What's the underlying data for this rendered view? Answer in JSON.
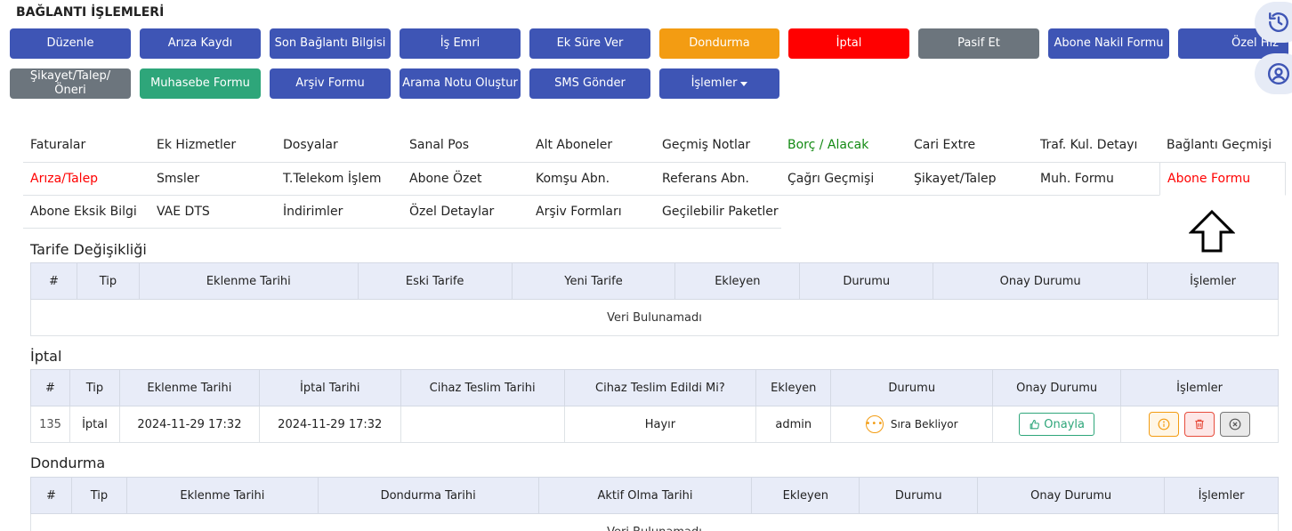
{
  "header": {
    "title": "BAĞLANTI İŞLEMLERİ"
  },
  "toolbar": {
    "row1": [
      "Düzenle",
      "Arıza Kaydı",
      "Son Bağlantı Bilgisi",
      "İş Emri",
      "Ek Süre Ver",
      "Dondurma",
      "İptal",
      "Pasif Et",
      "Abone Nakil Formu",
      "Özel Hız"
    ],
    "row2": [
      "Şikayet/Talep/ Öneri",
      "Muhasebe Formu",
      "Arşiv Formu",
      "Arama Notu Oluştur",
      "SMS Gönder",
      "İşlemler"
    ]
  },
  "colors": {
    "blue": "#3e55b5",
    "orange": "#f39c12",
    "red": "#ff0000",
    "gray": "#6c757d",
    "green": "#2ea67a"
  },
  "side_icons": [
    "history-icon",
    "user-circle-icon"
  ],
  "tabs": {
    "row1": [
      "Faturalar",
      "Ek Hizmetler",
      "Dosyalar",
      "Sanal Pos",
      "Alt Aboneler",
      "Geçmiş Notlar",
      "Borç / Alacak",
      "Cari Extre",
      "Traf. Kul. Detayı",
      "Bağlantı Geçmişi"
    ],
    "row2": [
      "Arıza/Talep",
      "Smsler",
      "T.Telekom İşlem",
      "Abone Özet",
      "Komşu Abn.",
      "Referans Abn.",
      "Çağrı Geçmişi",
      "Şikayet/Talep",
      "Muh. Formu",
      "Abone Formu"
    ],
    "row3": [
      "Abone Eksik Bilgi",
      "VAE DTS",
      "İndirimler",
      "Özel Detaylar",
      "Arşiv Formları",
      "Geçilebilir Paketler"
    ],
    "active": "Abone Formu"
  },
  "tarife": {
    "title": "Tarife Değişikliği",
    "columns": [
      "#",
      "Tip",
      "Eklenme Tarihi",
      "Eski Tarife",
      "Yeni Tarife",
      "Ekleyen",
      "Durumu",
      "Onay Durumu",
      "İşlemler"
    ],
    "empty": "Veri Bulunamadı"
  },
  "iptal": {
    "title": "İptal",
    "columns": [
      "#",
      "Tip",
      "Eklenme Tarihi",
      "İptal Tarihi",
      "Cihaz Teslim Tarihi",
      "Cihaz Teslim Edildi Mi?",
      "Ekleyen",
      "Durumu",
      "Onay Durumu",
      "İşlemler"
    ],
    "row": {
      "id": "135",
      "tip": "İptal",
      "eklenme": "2024-11-29 17:32",
      "iptal": "2024-11-29 17:32",
      "teslim_tarihi": "",
      "teslim_edildi": "Hayır",
      "ekleyen": "admin",
      "durum": "Sıra Bekliyor",
      "onay": "Onayla"
    }
  },
  "dondurma": {
    "title": "Dondurma",
    "columns": [
      "#",
      "Tip",
      "Eklenme Tarihi",
      "Dondurma Tarihi",
      "Aktif Olma Tarihi",
      "Ekleyen",
      "Durumu",
      "Onay Durumu",
      "İşlemler"
    ],
    "empty": "Veri Bulunamadı"
  }
}
